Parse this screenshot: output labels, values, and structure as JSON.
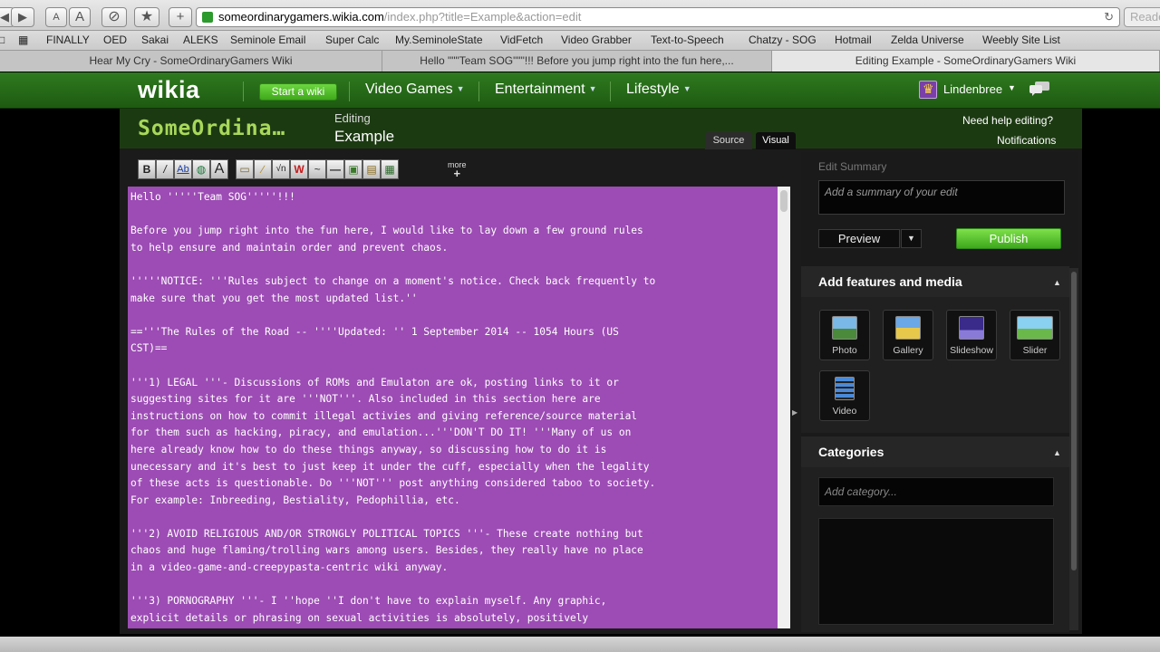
{
  "browser": {
    "url_host": "someordinarygamers.wikia.com",
    "url_path": "/index.php?title=Example&action=edit",
    "reader_label": "Reader",
    "toolbar_buttons": [
      "◀",
      "▶",
      "A",
      "A",
      "⊘",
      "★",
      "+"
    ]
  },
  "bookmarks": [
    "FINALLY",
    "OED",
    "Sakai",
    "ALEKS",
    "Seminole Email",
    "Super Calc",
    "My.SeminoleState",
    "VidFetch",
    "Video Grabber",
    "Text-to-Speech",
    "Chatzy - SOG",
    "Hotmail",
    "Zelda Universe",
    "Weebly Site List"
  ],
  "tabs": [
    {
      "label": "Hear My Cry - SomeOrdinaryGamers Wiki",
      "active": false
    },
    {
      "label": "Hello \"\"\"Team SOG\"\"\"!!! Before you jump right into the fun here,...",
      "active": false
    },
    {
      "label": "Editing Example - SomeOrdinaryGamers Wiki",
      "active": true
    }
  ],
  "global_nav": {
    "logo": "wikia",
    "start_wiki": "Start a wiki",
    "menus": [
      "Video Games",
      "Entertainment",
      "Lifestyle"
    ],
    "username": "Lindenbree"
  },
  "editor": {
    "wiki_name": "SomeOrdina…",
    "editing_label": "Editing",
    "page_name": "Example",
    "help_link": "Need help editing?",
    "notifications_link": "Notifications",
    "source_tab": "Source",
    "visual_tab": "Visual",
    "more_label": "more",
    "tool_icons": [
      "bold-icon",
      "italic-icon",
      "link-icon",
      "external-link-icon",
      "headline-icon",
      "image-icon",
      "signature-icon",
      "math-icon",
      "nowiki-icon",
      "signature-pen-icon",
      "horizontal-line-icon",
      "gallery-icon",
      "template-icon",
      "table-icon"
    ],
    "content": "Hello '''''Team SOG'''''!!!\n\nBefore you jump right into the fun here, I would like to lay down a few ground rules\nto help ensure and maintain order and prevent chaos.\n\n'''''NOTICE: '''Rules subject to change on a moment's notice. Check back frequently to\nmake sure that you get the most updated list.''\n\n=='''The Rules of the Road -- ''''Updated: '' 1 September 2014 -- 1054 Hours (US\nCST)==\n\n'''1) LEGAL '''- Discussions of ROMs and Emulaton are ok, posting links to it or\nsuggesting sites for it are '''NOT'''. Also included in this section here are\ninstructions on how to commit illegal activies and giving reference/source material\nfor them such as hacking, piracy, and emulation...'''DON'T DO IT! '''Many of us on\nhere already know how to do these things anyway, so discussing how to do it is\nunecessary and it's best to just keep it under the cuff, especially when the legality\nof these acts is questionable. Do '''NOT''' post anything considered taboo to society.\nFor example: Inbreeding, Bestiality, Pedophillia, etc.\n\n'''2) AVOID RELIGIOUS AND/OR STRONGLY POLITICAL TOPICS '''- These create nothing but\nchaos and huge flaming/trolling wars among users. Besides, they really have no place\nin a video-game-and-creepypasta-centric wiki anyway.\n\n'''3) PORNOGRAPHY '''- I ''hope ''I don't have to explain myself. Any graphic,\nexplicit details or phrasing on sexual activities is absolutely, positively"
  },
  "rail": {
    "summary_label": "Edit Summary",
    "summary_placeholder": "Add a summary of your edit",
    "preview_label": "Preview",
    "publish_label": "Publish",
    "features_title": "Add features and media",
    "media": [
      {
        "label": "Photo",
        "icon": "photo-icon"
      },
      {
        "label": "Gallery",
        "icon": "gallery-icon"
      },
      {
        "label": "Slideshow",
        "icon": "slideshow-icon"
      },
      {
        "label": "Slider",
        "icon": "slider-icon"
      },
      {
        "label": "Video",
        "icon": "video-icon"
      }
    ],
    "categories_title": "Categories",
    "category_placeholder": "Add category..."
  },
  "colors": {
    "wikia_green": "#2f7a1f",
    "editor_bg": "#9c4cb4",
    "publish_green": "#5cc430",
    "wiki_name_green": "#a8d85a"
  }
}
